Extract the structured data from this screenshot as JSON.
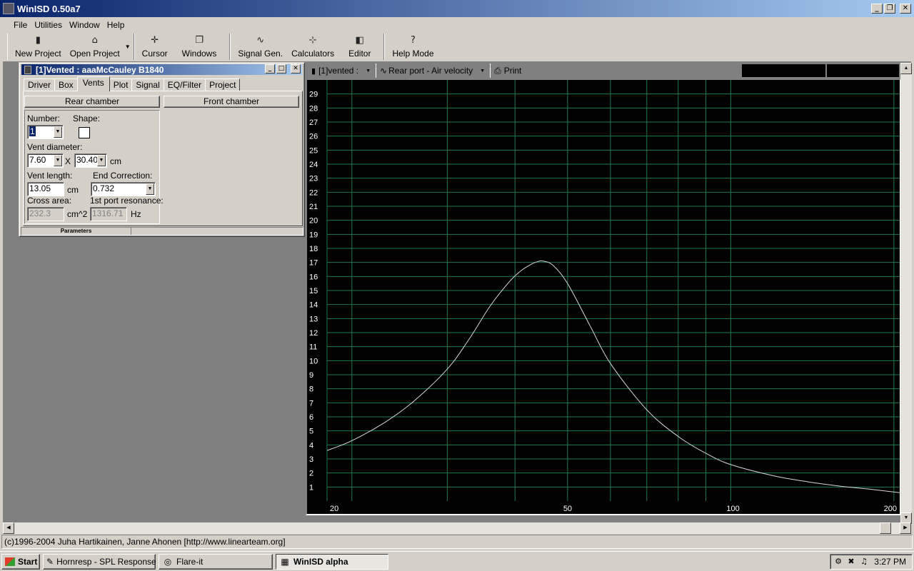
{
  "app": {
    "title": "WinISD 0.50a7"
  },
  "menu": [
    "File",
    "Utilities",
    "Window",
    "Help"
  ],
  "toolbar": {
    "new_project": "New Project",
    "open_project": "Open Project",
    "cursor": "Cursor",
    "windows": "Windows",
    "signal_gen": "Signal Gen.",
    "calculators": "Calculators",
    "editor": "Editor",
    "help_mode": "Help Mode"
  },
  "vent_window": {
    "title": "[1]Vented : aaaMcCauley B1840",
    "tabs": [
      "Driver",
      "Box",
      "Vents",
      "Plot",
      "Signal",
      "EQ/Filter",
      "Project"
    ],
    "active_tab": "Vents",
    "rear_chamber": "Rear chamber",
    "front_chamber": "Front chamber",
    "number_label": "Number:",
    "number_value": "1",
    "shape_label": "Shape:",
    "vent_diameter_label": "Vent diameter:",
    "vent_diameter_a": "7.60",
    "times": "X",
    "vent_diameter_b": "30.40",
    "vent_diameter_unit": "cm",
    "vent_length_label": "Vent length:",
    "vent_length_value": "13.05",
    "vent_length_unit": "cm",
    "end_correction_label": "End Correction:",
    "end_correction_value": "0.732",
    "cross_area_label": "Cross area:",
    "cross_area_value": "232.3",
    "cross_area_unit": "cm^2",
    "port_resonance_label": "1st port resonance:",
    "port_resonance_value": "1316.71",
    "port_resonance_unit": "Hz",
    "parameters_label": "Parameters"
  },
  "plot_toolbar": {
    "project_select": "[1]vented :",
    "plot_select": "Rear port - Air velocity",
    "print": "Print"
  },
  "chart_data": {
    "type": "line",
    "x_scale": "log",
    "xlim": [
      18,
      205
    ],
    "ylim": [
      0,
      30
    ],
    "x_tick_labels": [
      "20",
      "50",
      "100",
      "200"
    ],
    "y_tick_labels": [
      "1",
      "2",
      "3",
      "4",
      "5",
      "6",
      "7",
      "8",
      "9",
      "10",
      "11",
      "12",
      "13",
      "14",
      "15",
      "16",
      "17",
      "18",
      "19",
      "20",
      "21",
      "22",
      "23",
      "24",
      "25",
      "26",
      "27",
      "28",
      "29"
    ],
    "grid": true,
    "colors": {
      "background": "#000000",
      "grid": "#1f7a50",
      "curve": "#d8d8d8",
      "labels": "#ffffff"
    },
    "series": [
      {
        "x": [
          18,
          20,
          23,
          26,
          30,
          33,
          36,
          39,
          41,
          43,
          44,
          45,
          47,
          50,
          55,
          60,
          70,
          80,
          90,
          100,
          120,
          140,
          160,
          180,
          205
        ],
        "y": [
          3.6,
          4.3,
          5.6,
          7.1,
          9.4,
          11.6,
          13.9,
          15.6,
          16.4,
          16.9,
          17.05,
          17.1,
          16.8,
          15.5,
          12.5,
          9.8,
          6.5,
          4.6,
          3.4,
          2.6,
          1.8,
          1.35,
          1.05,
          0.85,
          0.6
        ]
      }
    ]
  },
  "status": "(c)1996-2004 Juha Hartikainen, Janne Ahonen [http://www.linearteam.org]",
  "taskbar": {
    "start": "Start",
    "tasks": [
      "Hornresp - SPL Response",
      "Flare-it",
      "WinISD alpha"
    ],
    "active_task": "WinISD alpha",
    "clock": "3:27 PM"
  }
}
